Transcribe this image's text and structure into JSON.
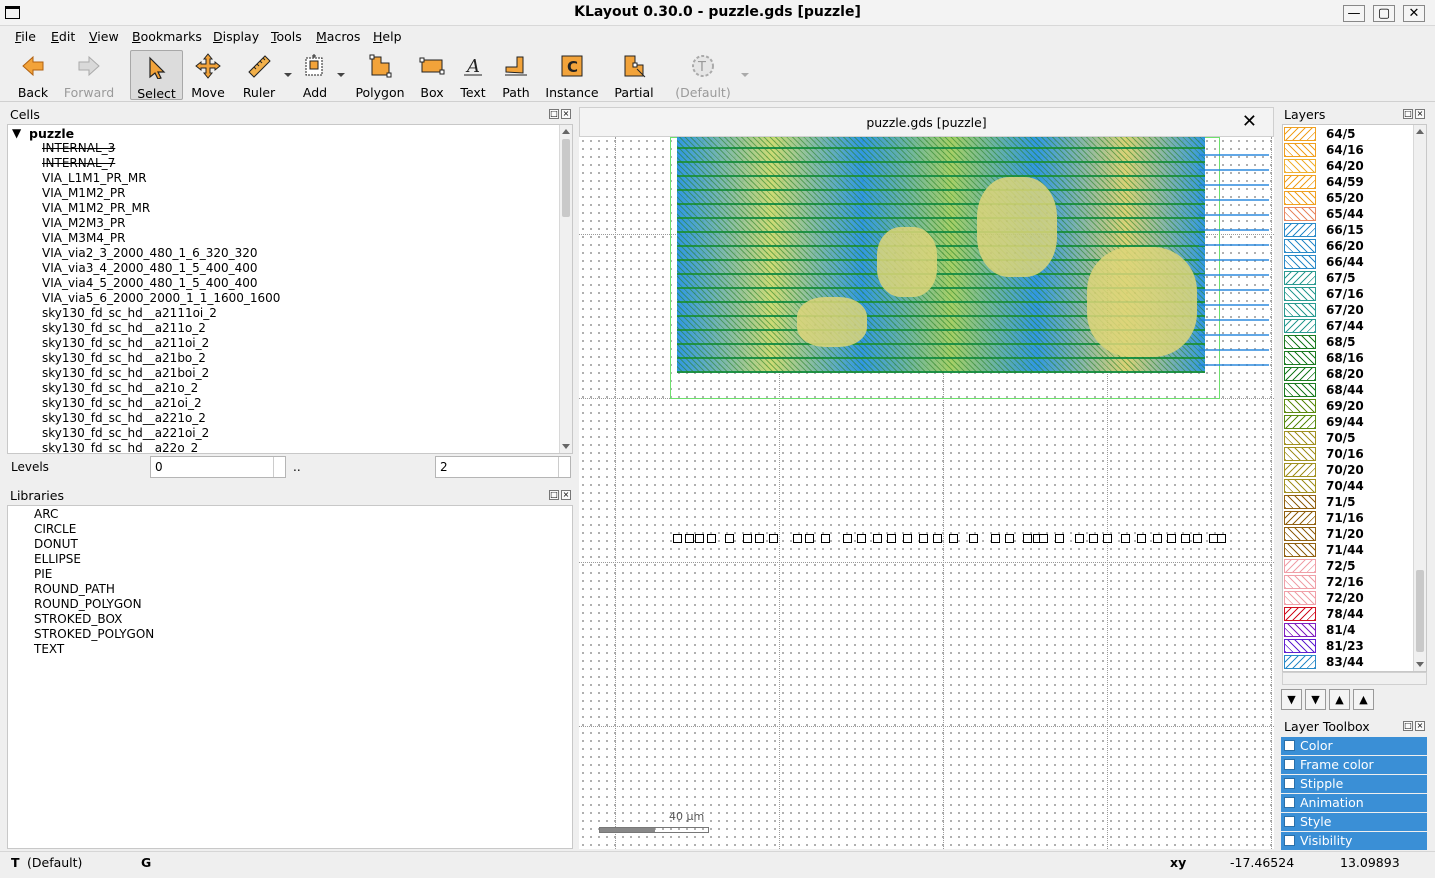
{
  "window": {
    "title": "KLayout 0.30.0 - puzzle.gds [puzzle]"
  },
  "menu": [
    "File",
    "Edit",
    "View",
    "Bookmarks",
    "Display",
    "Tools",
    "Macros",
    "Help"
  ],
  "toolbar": {
    "back": "Back",
    "forward": "Forward",
    "select": "Select",
    "move": "Move",
    "ruler": "Ruler",
    "add": "Add",
    "polygon": "Polygon",
    "box": "Box",
    "text": "Text",
    "path": "Path",
    "instance": "Instance",
    "partial": "Partial",
    "default": "(Default)"
  },
  "cells": {
    "title": "Cells",
    "root": "puzzle",
    "items": [
      {
        "name": "INTERNAL_3",
        "strike": true
      },
      {
        "name": "INTERNAL_7",
        "strike": true
      },
      {
        "name": "VIA_L1M1_PR_MR"
      },
      {
        "name": "VIA_M1M2_PR"
      },
      {
        "name": "VIA_M1M2_PR_MR"
      },
      {
        "name": "VIA_M2M3_PR"
      },
      {
        "name": "VIA_M3M4_PR"
      },
      {
        "name": "VIA_via2_3_2000_480_1_6_320_320"
      },
      {
        "name": "VIA_via3_4_2000_480_1_5_400_400"
      },
      {
        "name": "VIA_via4_5_2000_480_1_5_400_400"
      },
      {
        "name": "VIA_via5_6_2000_2000_1_1_1600_1600"
      },
      {
        "name": "sky130_fd_sc_hd__a2111oi_2"
      },
      {
        "name": "sky130_fd_sc_hd__a211o_2"
      },
      {
        "name": "sky130_fd_sc_hd__a211oi_2"
      },
      {
        "name": "sky130_fd_sc_hd__a21bo_2"
      },
      {
        "name": "sky130_fd_sc_hd__a21boi_2"
      },
      {
        "name": "sky130_fd_sc_hd__a21o_2"
      },
      {
        "name": "sky130_fd_sc_hd__a21oi_2"
      },
      {
        "name": "sky130_fd_sc_hd__a221o_2"
      },
      {
        "name": "sky130_fd_sc_hd__a221oi_2"
      },
      {
        "name": "sky130_fd_sc_hd__a22o_2"
      }
    ]
  },
  "levels": {
    "label": "Levels",
    "from": "0",
    "sep": "..",
    "to": "2"
  },
  "libraries": {
    "title": "Libraries",
    "items": [
      "ARC",
      "CIRCLE",
      "DONUT",
      "ELLIPSE",
      "PIE",
      "ROUND_PATH",
      "ROUND_POLYGON",
      "STROKED_BOX",
      "STROKED_POLYGON",
      "TEXT"
    ]
  },
  "view": {
    "tab_title": "puzzle.gds [puzzle]",
    "scale_label": "40 µm"
  },
  "layers": {
    "title": "Layers",
    "items": [
      {
        "name": "64/5",
        "color": "#f0a020"
      },
      {
        "name": "64/16",
        "color": "#f0a020"
      },
      {
        "name": "64/20",
        "color": "#f0b030"
      },
      {
        "name": "64/59",
        "color": "#f0a020"
      },
      {
        "name": "65/20",
        "color": "#f0a020"
      },
      {
        "name": "65/44",
        "color": "#e88860"
      },
      {
        "name": "66/15",
        "color": "#2a8ac8"
      },
      {
        "name": "66/20",
        "color": "#2a8ac8"
      },
      {
        "name": "66/44",
        "color": "#2a8ac8"
      },
      {
        "name": "67/5",
        "color": "#2a9a90"
      },
      {
        "name": "67/16",
        "color": "#2a9a90"
      },
      {
        "name": "67/20",
        "color": "#2a9a90"
      },
      {
        "name": "67/44",
        "color": "#2a9a90"
      },
      {
        "name": "68/5",
        "color": "#1a7a20"
      },
      {
        "name": "68/16",
        "color": "#1a7a20"
      },
      {
        "name": "68/20",
        "color": "#1a7a20"
      },
      {
        "name": "68/44",
        "color": "#1a7a20"
      },
      {
        "name": "69/20",
        "color": "#5a8a10"
      },
      {
        "name": "69/44",
        "color": "#5a8a10"
      },
      {
        "name": "70/5",
        "color": "#a09020"
      },
      {
        "name": "70/16",
        "color": "#a09020"
      },
      {
        "name": "70/20",
        "color": "#a09020"
      },
      {
        "name": "70/44",
        "color": "#a09020"
      },
      {
        "name": "71/5",
        "color": "#906010"
      },
      {
        "name": "71/16",
        "color": "#906010"
      },
      {
        "name": "71/20",
        "color": "#906010"
      },
      {
        "name": "71/44",
        "color": "#906010"
      },
      {
        "name": "72/5",
        "color": "#f0a0a8"
      },
      {
        "name": "72/16",
        "color": "#f0a0a8"
      },
      {
        "name": "72/20",
        "color": "#f0a0a8"
      },
      {
        "name": "78/44",
        "color": "#d01020"
      },
      {
        "name": "81/4",
        "color": "#8020c0"
      },
      {
        "name": "81/23",
        "color": "#6020d0"
      },
      {
        "name": "83/44",
        "color": "#2a8ac8"
      }
    ]
  },
  "toolbox": {
    "title": "Layer Toolbox",
    "items": [
      "Color",
      "Frame color",
      "Stipple",
      "Animation",
      "Style",
      "Visibility"
    ]
  },
  "status": {
    "mode_key": "T",
    "mode": "(Default)",
    "grid_key": "G",
    "coord_label": "xy",
    "x": "-17.46524",
    "y": "13.09893"
  }
}
